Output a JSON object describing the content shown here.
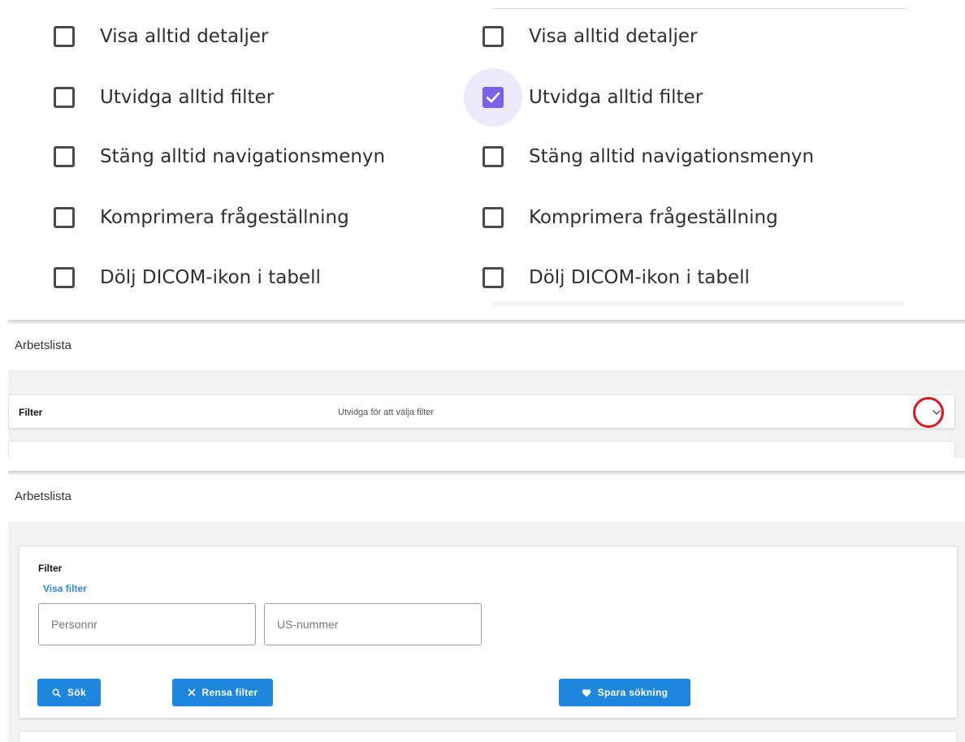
{
  "settings_before": {
    "options": [
      {
        "label": "Visa alltid detaljer",
        "checked": false
      },
      {
        "label": "Utvidga alltid filter",
        "checked": false
      },
      {
        "label": "Stäng alltid navigationsmenyn",
        "checked": false
      },
      {
        "label": "Komprimera frågeställning",
        "checked": false
      },
      {
        "label": "Dölj DICOM-ikon i tabell",
        "checked": false
      }
    ]
  },
  "settings_after": {
    "options": [
      {
        "label": "Visa alltid detaljer",
        "checked": false
      },
      {
        "label": "Utvidga alltid filter",
        "checked": true
      },
      {
        "label": "Stäng alltid navigationsmenyn",
        "checked": false
      },
      {
        "label": "Komprimera frågeställning",
        "checked": false
      },
      {
        "label": "Dölj DICOM-ikon i tabell",
        "checked": false
      }
    ]
  },
  "collapsed_view": {
    "page_title": "Arbetslista",
    "filter_label": "Filter",
    "filter_hint": "Utvidga för att välja filter",
    "expand_icon": "chevron-down-icon"
  },
  "expanded_view": {
    "page_title": "Arbetslista",
    "filter_label": "Filter",
    "show_filter_link": "Visa filter",
    "personnr_placeholder": "Personnr",
    "us_nummer_placeholder": "US-nummer",
    "search_button": "Sök",
    "clear_button": "Rensa filter",
    "save_button": "Spara sökning",
    "icons": {
      "search": "search-icon",
      "clear": "close-icon",
      "save": "heart-icon"
    }
  },
  "colors": {
    "checkbox_checked": "#7b62e6",
    "checkbox_halo": "#ece9fb",
    "primary_button": "#1f86dd",
    "link": "#2d86d6",
    "highlight_circle": "#e0141e"
  }
}
